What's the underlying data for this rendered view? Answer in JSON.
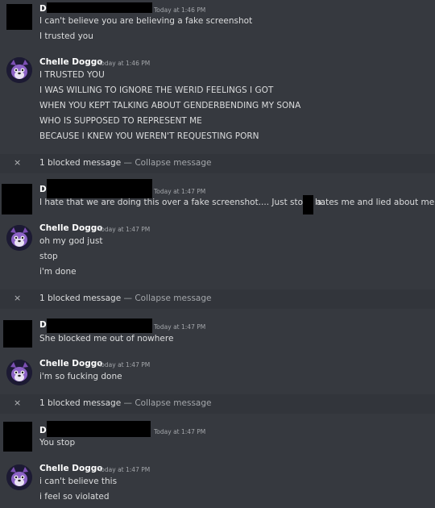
{
  "messages": [
    {
      "author": "D",
      "timestamp": "Today at 1:46 PM",
      "lines": [
        "I can't believe you are believing a fake screenshot",
        "I trusted you"
      ]
    },
    {
      "author": "Chelle Doggo",
      "timestamp": "Today at 1:46 PM",
      "lines": [
        "I TRUSTED YOU",
        "I WAS WILLING TO IGNORE THE WERID FEELINGS I GOT",
        "WHEN YOU KEPT TALKING ABOUT GENDERBENDING MY SONA",
        "WHO IS SUPPOSED TO REPRESENT ME",
        "BECAUSE I KNEW YOU WEREN'T REQUESTING PORN"
      ]
    },
    {
      "author": "D",
      "timestamp": "Today at 1:47 PM",
      "lines": [
        "I hate that we are doing this over a fake screenshot.... Just stop.. a",
        "hates me and lied about me"
      ]
    },
    {
      "author": "Chelle Doggo",
      "timestamp": "Today at 1:47 PM",
      "lines": [
        "oh my god just",
        "stop",
        "i'm done"
      ]
    },
    {
      "author": "D",
      "timestamp": "Today at 1:47 PM",
      "lines": [
        "She blocked me out of nowhere"
      ]
    },
    {
      "author": "Chelle Doggo",
      "timestamp": "Today at 1:47 PM",
      "lines": [
        "i'm so fucking done"
      ]
    },
    {
      "author": "D",
      "timestamp": "Today at 1:47 PM",
      "lines": [
        "You stop"
      ]
    },
    {
      "author": "Chelle Doggo",
      "timestamp": "Today at 1:47 PM",
      "lines": [
        "i can't believe this",
        "i feel so violated"
      ]
    }
  ],
  "blocked": {
    "close_glyph": "×",
    "text": "1 blocked message",
    "separator": " — ",
    "collapse": "Collapse message"
  },
  "colors": {
    "background": "#36393f",
    "blocked_bar": "#32353b",
    "text": "#dcddde",
    "muted": "#a3a6aa",
    "username": "#ffffff"
  }
}
